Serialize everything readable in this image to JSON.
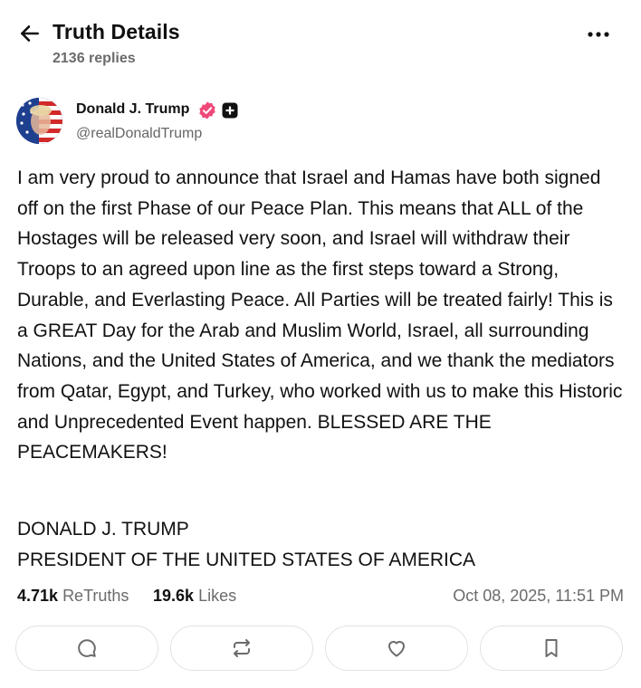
{
  "header": {
    "title": "Truth Details",
    "reply_count": "2136 replies",
    "back_icon": "arrow-left-icon",
    "more_icon": "more-horizontal-icon"
  },
  "author": {
    "name": "Donald J. Trump",
    "handle": "@realDonaldTrump",
    "verified_color": "#f0497a"
  },
  "post": {
    "body": "I am very proud to announce that Israel and Hamas have both signed off on the first Phase of our Peace Plan. This means that ALL of the Hostages will be released very soon, and Israel will withdraw their Troops to an agreed upon line as the first steps toward a Strong, Durable, and Everlasting Peace. All Parties will be treated fairly! This is a GREAT Day for the Arab and Muslim World, Israel, all surrounding Nations, and the United States of America, and we thank the mediators from Qatar, Egypt, and Turkey, who worked with us to make this Historic and Unprecedented Event happen. BLESSED ARE THE PEACEMAKERS!",
    "signature_line1": "DONALD J. TRUMP",
    "signature_line2": "PRESIDENT OF THE UNITED STATES OF AMERICA"
  },
  "stats": {
    "retruths_count": "4.71k",
    "retruths_label": "ReTruths",
    "likes_count": "19.6k",
    "likes_label": "Likes",
    "timestamp": "Oct 08, 2025, 11:51 PM"
  },
  "actions": [
    {
      "icon": "reply-icon"
    },
    {
      "icon": "retruth-icon"
    },
    {
      "icon": "heart-icon"
    },
    {
      "icon": "bookmark-icon"
    }
  ]
}
